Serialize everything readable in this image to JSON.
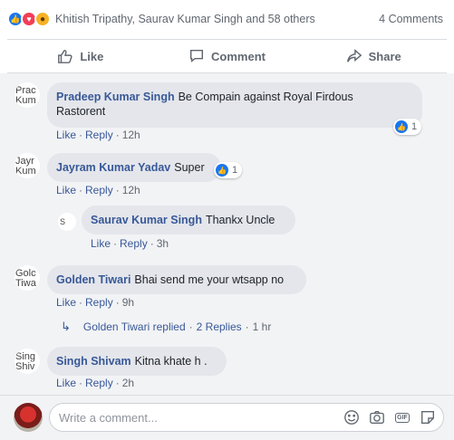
{
  "summary": {
    "reactions": [
      "like-icon",
      "love-icon",
      "wow-icon"
    ],
    "names": "Khitish Tripathy, Saurav Kumar Singh and 58 others",
    "comments_count": "4 Comments"
  },
  "actions": {
    "like": "Like",
    "comment": "Comment",
    "share": "Share"
  },
  "comments": [
    {
      "avatar_text": "Prac Kum",
      "author": "Pradeep Kumar Singh",
      "text_line1": "Be Compain against Royal Firdous",
      "text_line2": "Rastorent",
      "like": "Like",
      "reply": "Reply",
      "time": "12h",
      "reactions": "1"
    },
    {
      "avatar_text": "Jayr Kum",
      "author": "Jayram Kumar Yadav",
      "text": "Super",
      "like": "Like",
      "reply": "Reply",
      "time": "12h",
      "reactions": "1"
    },
    {
      "avatar_text": "S",
      "author": "Saurav Kumar Singh",
      "text": "Thankx Uncle",
      "like": "Like",
      "reply": "Reply",
      "time": "3h"
    },
    {
      "avatar_text": "Golc Tiwa",
      "author": "Golden Tiwari",
      "text": "Bhai send me your wtsapp no",
      "like": "Like",
      "reply": "Reply",
      "time": "9h"
    },
    {
      "avatar_text": "Sing Shiv",
      "author": "Singh Shivam",
      "text": "Kitna khate h .",
      "like": "Like",
      "reply": "Reply",
      "time": "2h"
    }
  ],
  "reply_summary": {
    "who": "Golden Tiwari replied",
    "count": "2 Replies",
    "time": "1 hr"
  },
  "composer": {
    "placeholder": "Write a comment...",
    "gif_label": "GIF",
    "tools": [
      "emoji-icon",
      "camera-icon",
      "gif-icon",
      "sticker-icon"
    ]
  },
  "colors": {
    "link": "#385898",
    "like_blue": "#1877f2",
    "love_red": "#f33e58",
    "wow_yellow": "#f7b125",
    "bubble": "#e4e6eb",
    "panel": "#f2f3f5"
  }
}
